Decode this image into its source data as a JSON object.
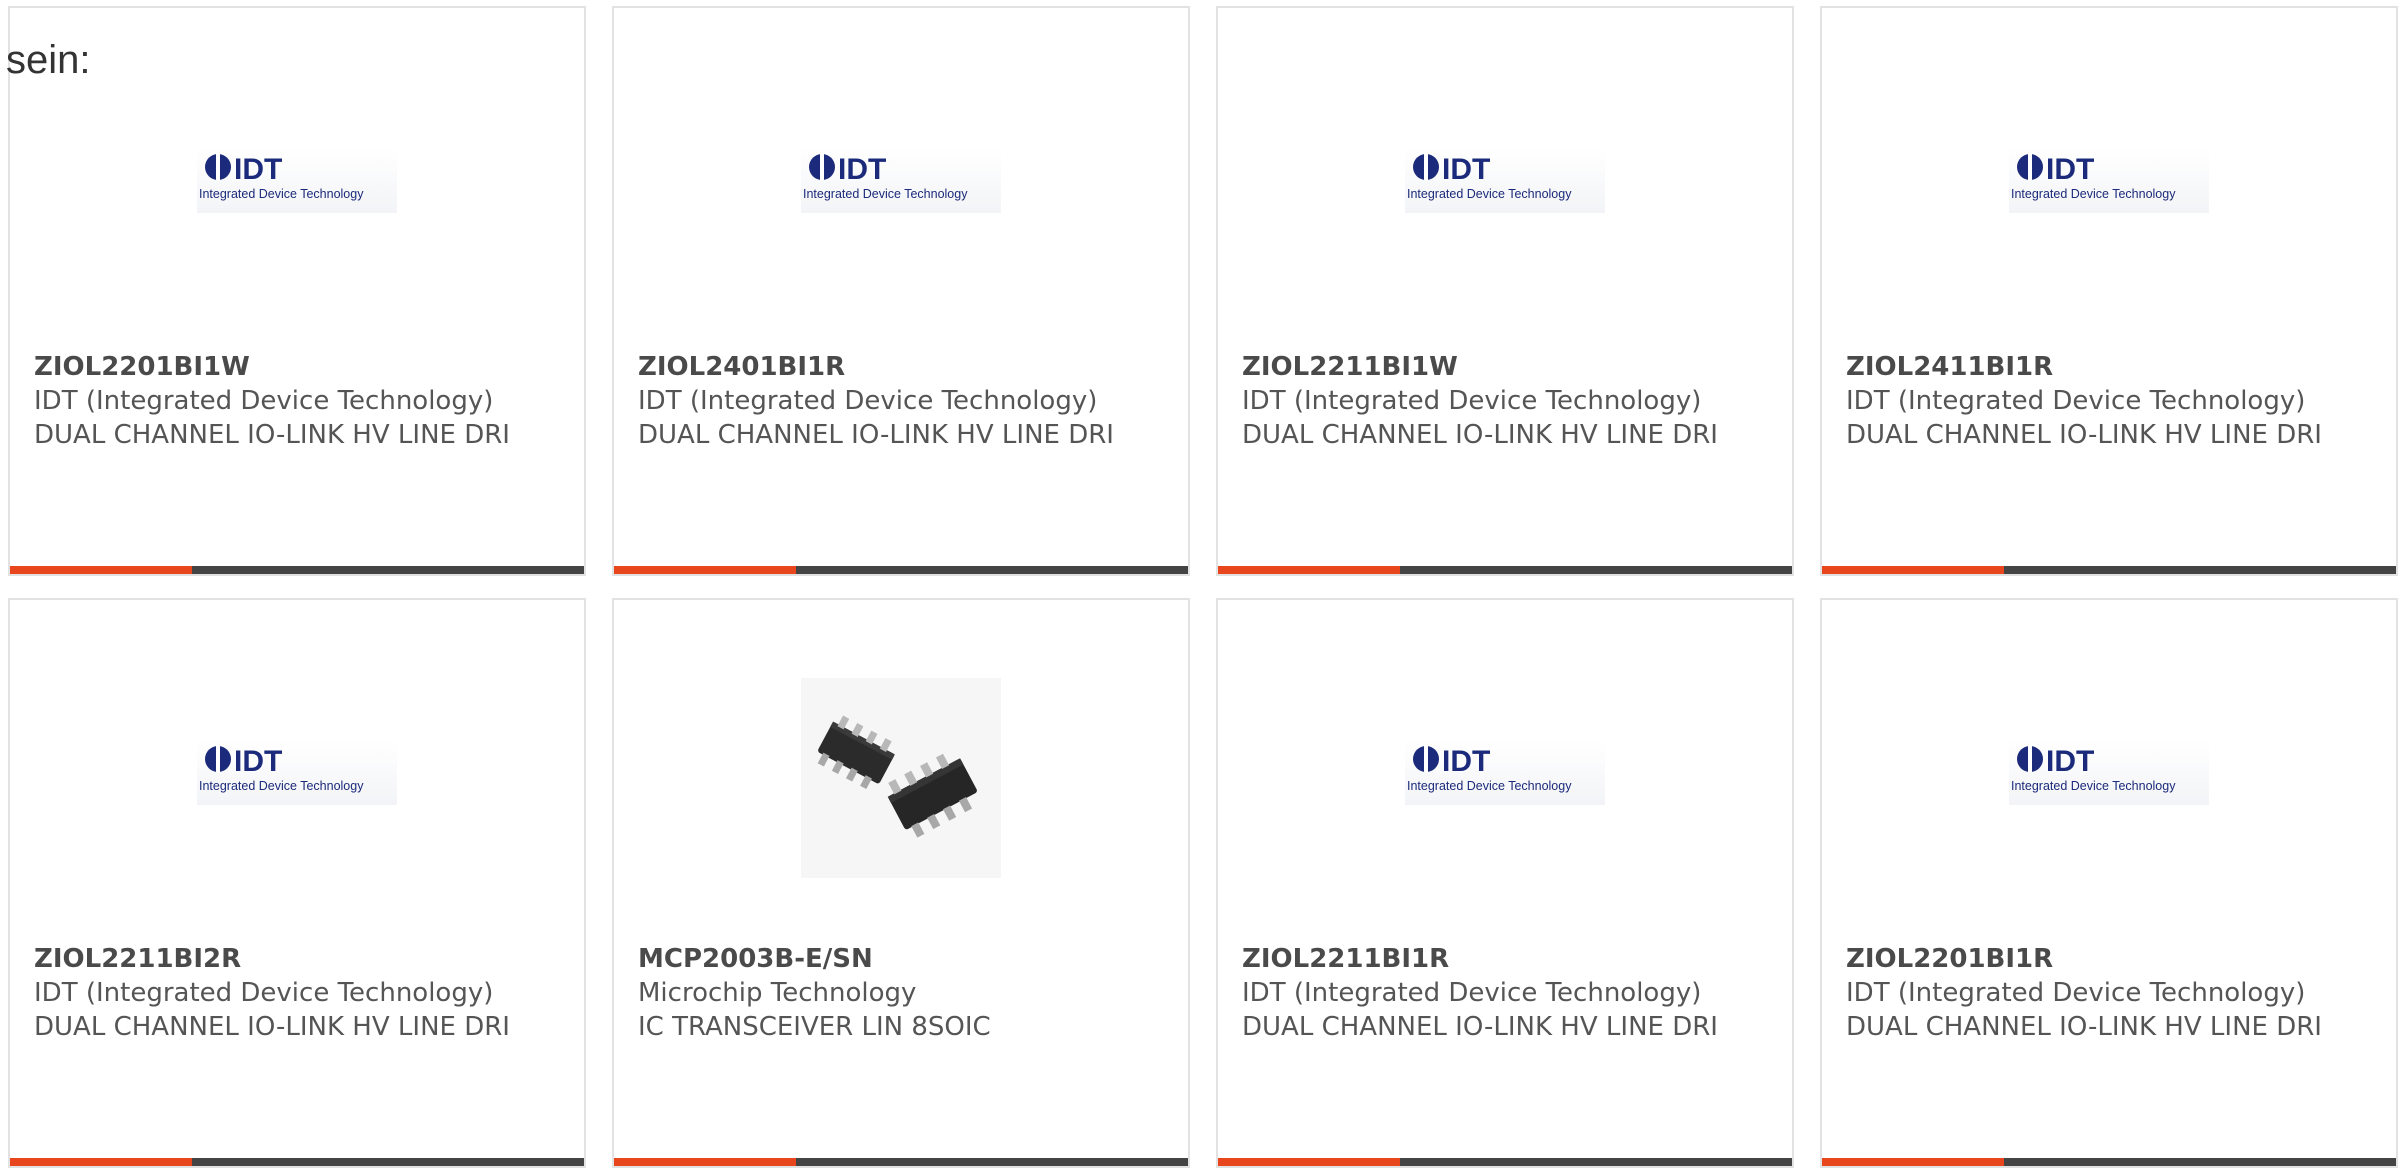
{
  "page": {
    "heading_fragment": "sein:"
  },
  "colors": {
    "accent": "#e8461c",
    "bar": "#444444",
    "idt_blue": "#1b2a7a"
  },
  "products": [
    {
      "part_number": "ZIOL2201BI1W",
      "manufacturer": "IDT (Integrated Device Technology)",
      "description": "DUAL CHANNEL IO-LINK HV LINE DRI",
      "image": "idt-logo",
      "logo_text": "IDT",
      "logo_tagline": "Integrated Device Technology"
    },
    {
      "part_number": "ZIOL2401BI1R",
      "manufacturer": "IDT (Integrated Device Technology)",
      "description": "DUAL CHANNEL IO-LINK HV LINE DRI",
      "image": "idt-logo",
      "logo_text": "IDT",
      "logo_tagline": "Integrated Device Technology"
    },
    {
      "part_number": "ZIOL2211BI1W",
      "manufacturer": "IDT (Integrated Device Technology)",
      "description": "DUAL CHANNEL IO-LINK HV LINE DRI",
      "image": "idt-logo",
      "logo_text": "IDT",
      "logo_tagline": "Integrated Device Technology"
    },
    {
      "part_number": "ZIOL2411BI1R",
      "manufacturer": "IDT (Integrated Device Technology)",
      "description": "DUAL CHANNEL IO-LINK HV LINE DRI",
      "image": "idt-logo",
      "logo_text": "IDT",
      "logo_tagline": "Integrated Device Technology"
    },
    {
      "part_number": "ZIOL2211BI2R",
      "manufacturer": "IDT (Integrated Device Technology)",
      "description": "DUAL CHANNEL IO-LINK HV LINE DRI",
      "image": "idt-logo",
      "logo_text": "IDT",
      "logo_tagline": "Integrated Device Technology"
    },
    {
      "part_number": "MCP2003B-E/SN",
      "manufacturer": "Microchip Technology",
      "description": "IC TRANSCEIVER LIN 8SOIC",
      "image": "soic-chip"
    },
    {
      "part_number": "ZIOL2211BI1R",
      "manufacturer": "IDT (Integrated Device Technology)",
      "description": "DUAL CHANNEL IO-LINK HV LINE DRI",
      "image": "idt-logo",
      "logo_text": "IDT",
      "logo_tagline": "Integrated Device Technology"
    },
    {
      "part_number": "ZIOL2201BI1R",
      "manufacturer": "IDT (Integrated Device Technology)",
      "description": "DUAL CHANNEL IO-LINK HV LINE DRI",
      "image": "idt-logo",
      "logo_text": "IDT",
      "logo_tagline": "Integrated Device Technology"
    }
  ]
}
